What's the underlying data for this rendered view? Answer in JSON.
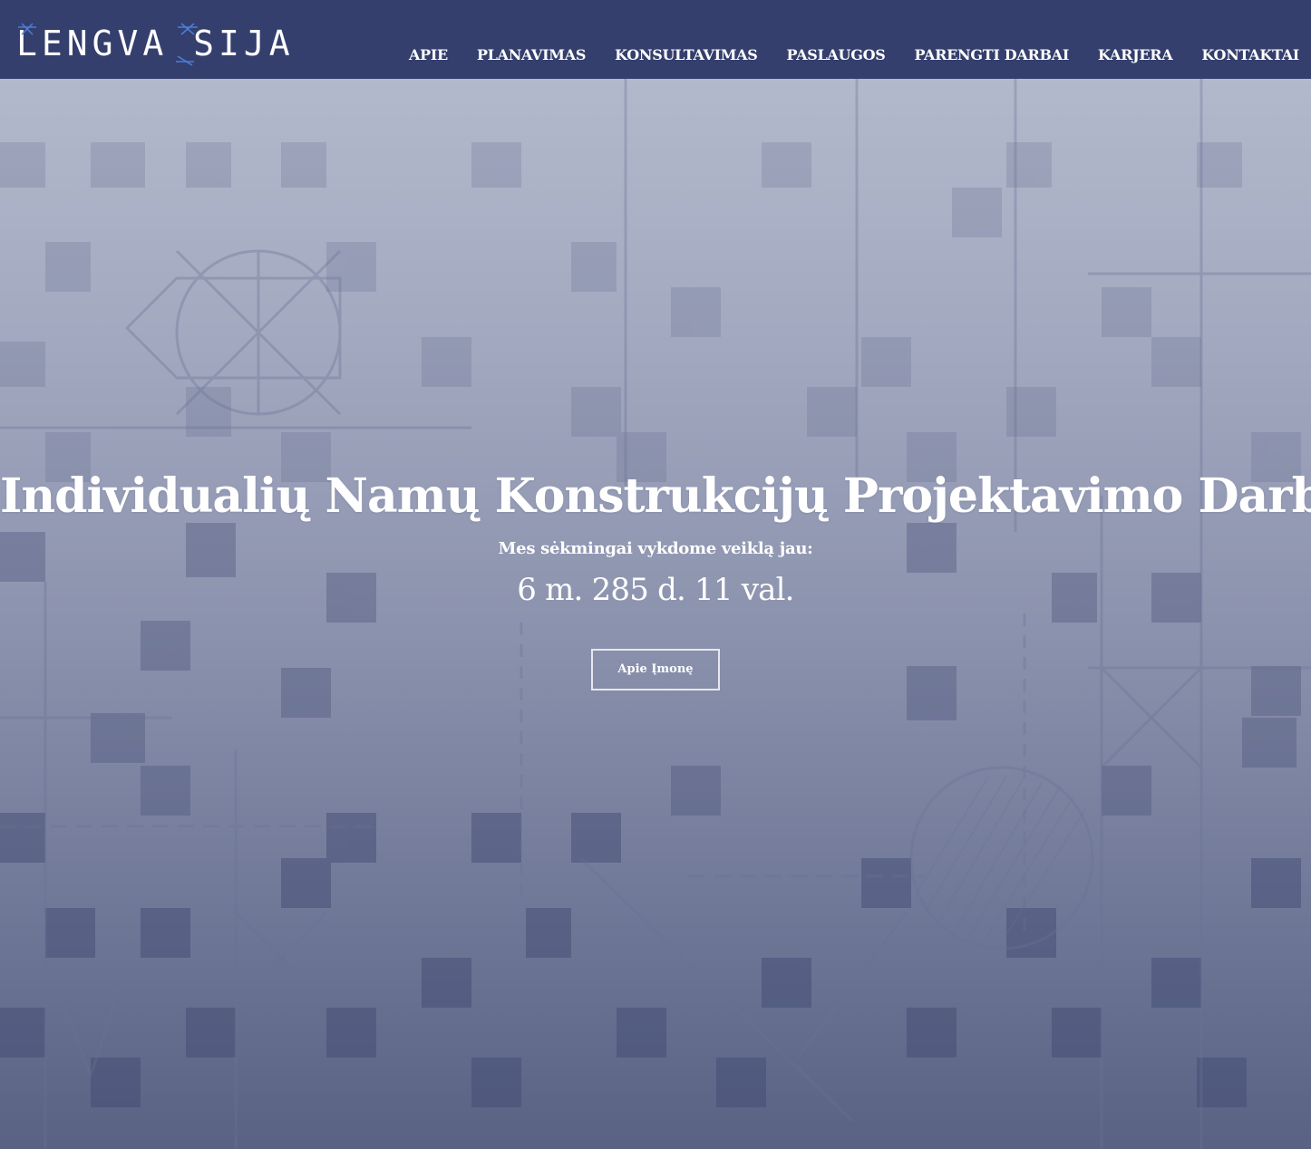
{
  "header": {
    "logo_text": "LENGVA SIJA",
    "nav": [
      {
        "label": "APIE"
      },
      {
        "label": "PLANAVIMAS"
      },
      {
        "label": "KONSULTAVIMAS"
      },
      {
        "label": "PASLAUGOS"
      },
      {
        "label": "PARENGTI DARBAI"
      },
      {
        "label": "KARJERA"
      },
      {
        "label": "KONTAKTAI"
      }
    ]
  },
  "hero": {
    "title": "Individualių Namų Konstrukcijų Projektavimo Darbai",
    "subtitle": "Mes sėkmingai vykdome veiklą jau:",
    "counter": "6 m. 285 d. 11 val.",
    "button_label": "Apie Įmonę"
  },
  "colors": {
    "header_bg": "#343f6d",
    "text": "#ffffff",
    "hero_top": "#b8bed0",
    "hero_bottom": "#5a6284"
  }
}
